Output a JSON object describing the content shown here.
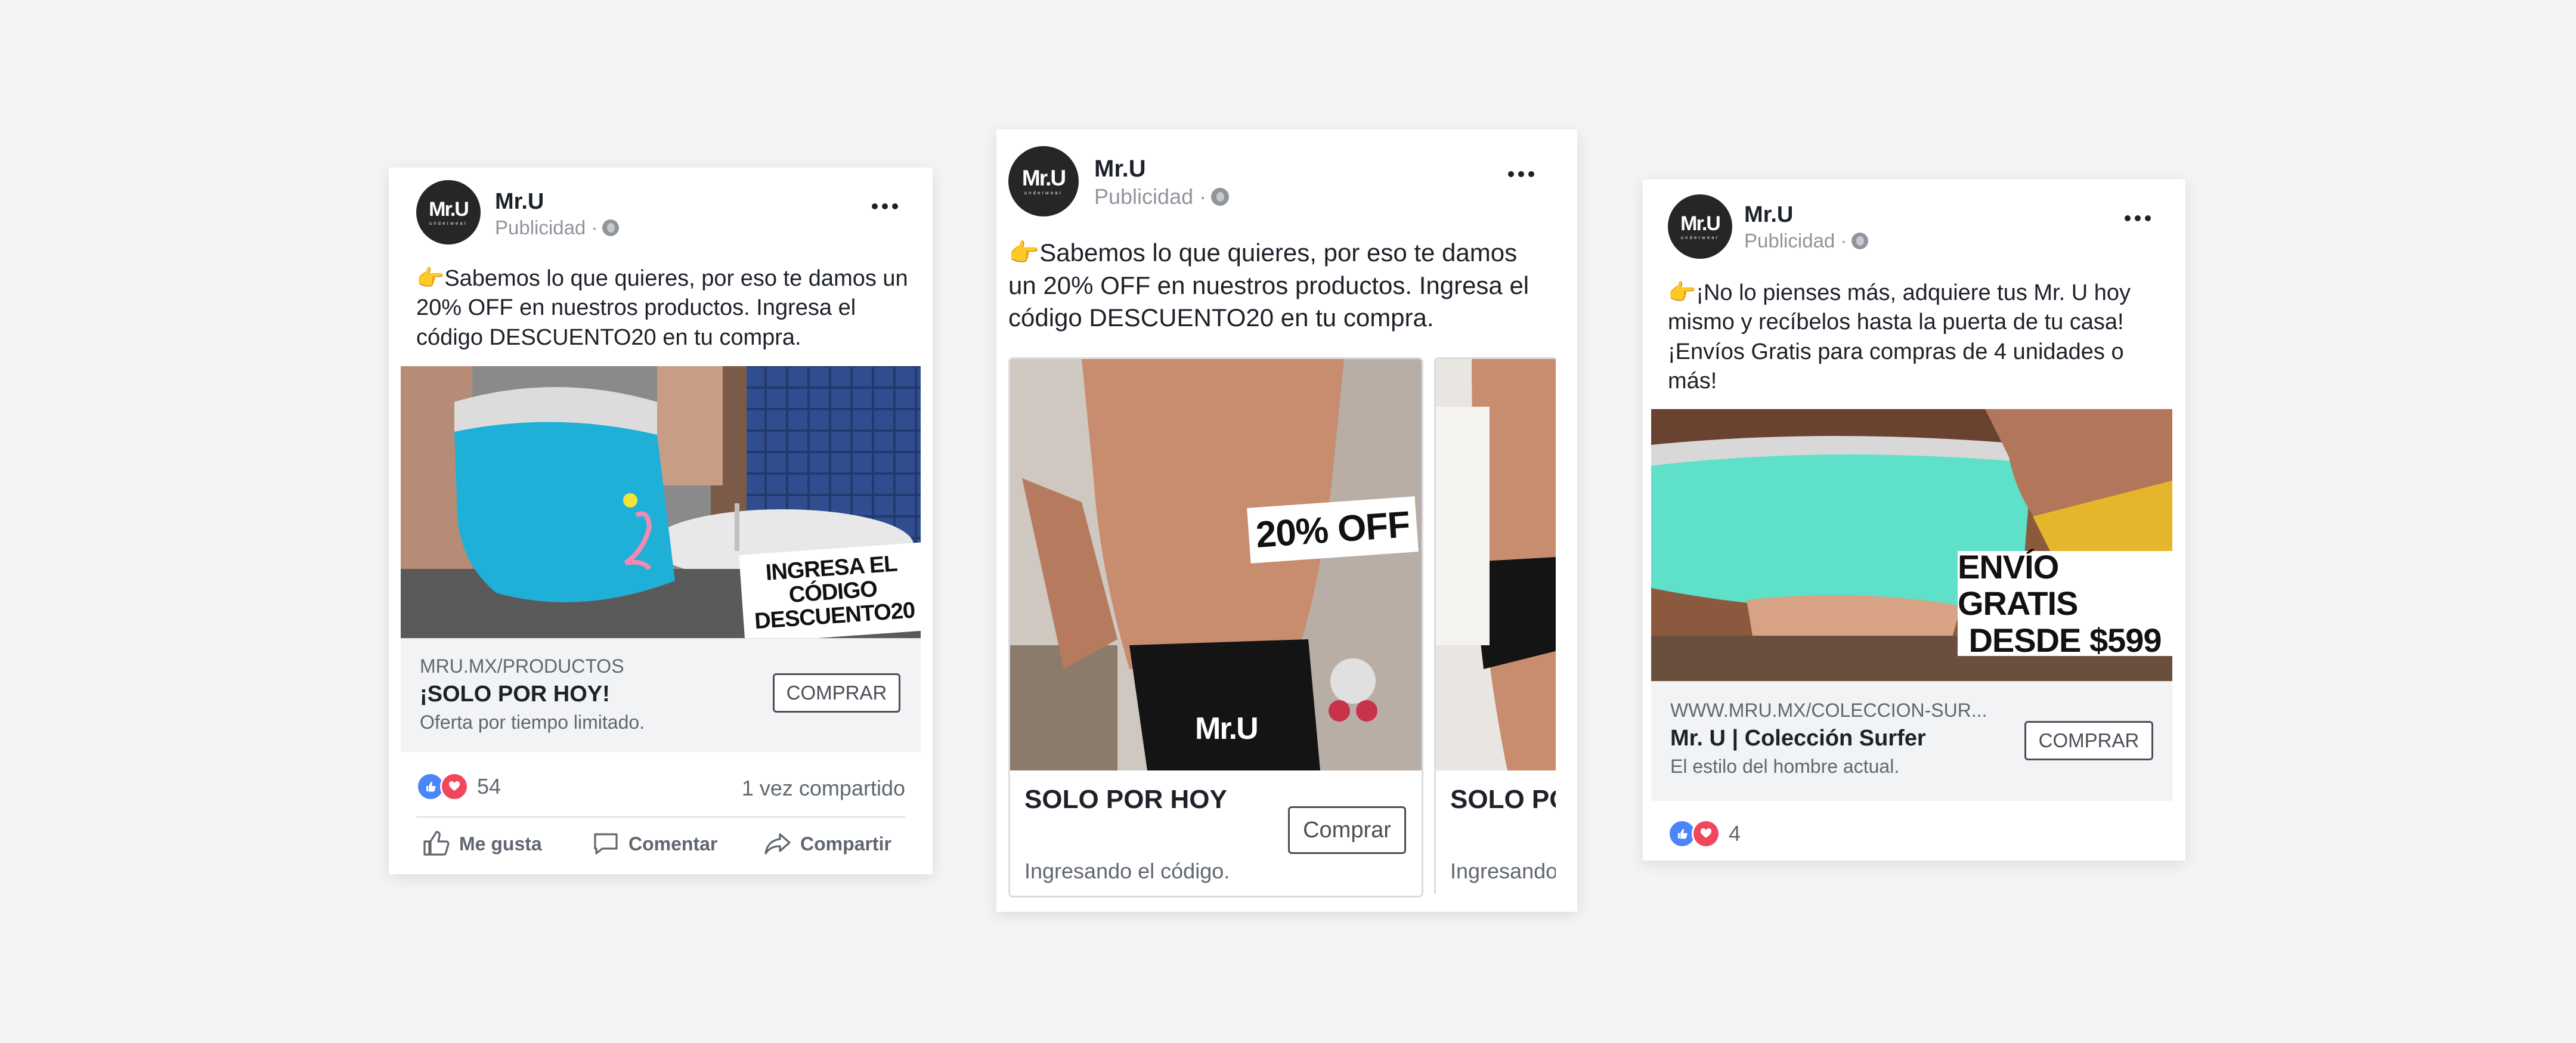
{
  "ads": [
    {
      "brand": "Mr.U",
      "logo_text": "Mr.U",
      "logo_sub": "underwear",
      "sponsored": "Publicidad ·",
      "text": "👉Sabemos lo que quieres, por eso te damos un 20% OFF en nuestros productos. Ingresa el código DESCUENTO20 en tu compra.",
      "image_overlay": [
        "INGRESA EL CÓDIGO",
        "DESCUENTO20"
      ],
      "link": {
        "url": "MRU.MX/PRODUCTOS",
        "title": "¡SOLO POR HOY!",
        "description": "Oferta por tiempo limitado.",
        "cta": "COMPRAR"
      },
      "reactions_count": "54",
      "shares": "1 vez compartido",
      "actions": {
        "like": "Me gusta",
        "comment": "Comentar",
        "share": "Compartir"
      }
    },
    {
      "brand": "Mr.U",
      "logo_text": "Mr.U",
      "logo_sub": "underwear",
      "sponsored": "Publicidad ·",
      "text": "👉Sabemos lo que quieres, por eso te damos un 20% OFF en nuestros productos. Ingresa el código DESCUENTO20 en tu compra.",
      "carousel": [
        {
          "image_overlay": "20% OFF",
          "title": "SOLO POR HOY",
          "cta": "Comprar",
          "description": "Ingresando el código."
        },
        {
          "title": "SOLO POR HOY",
          "description": "Ingresando el código."
        }
      ]
    },
    {
      "brand": "Mr.U",
      "logo_text": "Mr.U",
      "logo_sub": "underwear",
      "sponsored": "Publicidad ·",
      "text": "👉¡No lo pienses más, adquiere tus Mr. U hoy mismo y recíbelos hasta la puerta de tu casa! ¡Envíos Gratis para compras de 4 unidades o más!",
      "image_overlay": [
        "ENVÍO GRATIS",
        "DESDE $599"
      ],
      "link": {
        "url": "WWW.MRU.MX/COLECCION-SUR...",
        "title": "Mr. U | Colección Surfer",
        "description": "El estilo del hombre actual.",
        "cta": "COMPRAR"
      },
      "reactions_count": "4"
    }
  ],
  "colors": {
    "background": "#f4f4f4",
    "like_blue": "#4a86f7",
    "love_red": "#f0475c",
    "brief_blue": "#1fb0d8",
    "brief_mint": "#5fe0c8",
    "brief_black": "#141414"
  },
  "icons": [
    "globe-icon",
    "more-options-icon",
    "like-reaction-icon",
    "love-reaction-icon",
    "thumbs-up-icon",
    "comment-icon",
    "share-icon"
  ]
}
